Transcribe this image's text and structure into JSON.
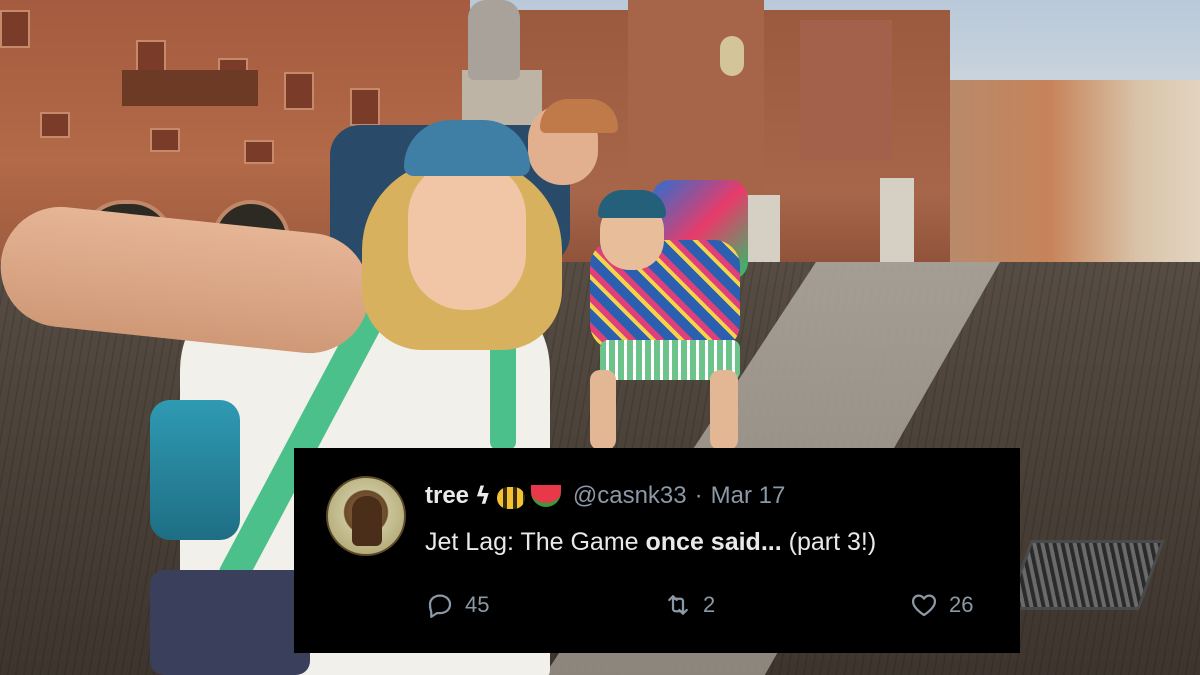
{
  "tweet": {
    "display_name": "tree",
    "name_emojis": [
      "lightning-emoji",
      "bee-emoji",
      "watermelon-emoji"
    ],
    "handle": "@casnk33",
    "separator": "·",
    "date": "Mar 17",
    "text_plain": "Jet Lag: The Game ",
    "text_bold": "once said...",
    "text_suffix": " (part 3!)",
    "replies": "45",
    "retweets": "2",
    "likes": "26"
  },
  "icons": {
    "reply": "reply-icon",
    "retweet": "retweet-icon",
    "like": "heart-icon"
  },
  "colors": {
    "card_background": "#000000",
    "primary_text": "#e7e9ea",
    "secondary_text": "#8b98a5"
  }
}
